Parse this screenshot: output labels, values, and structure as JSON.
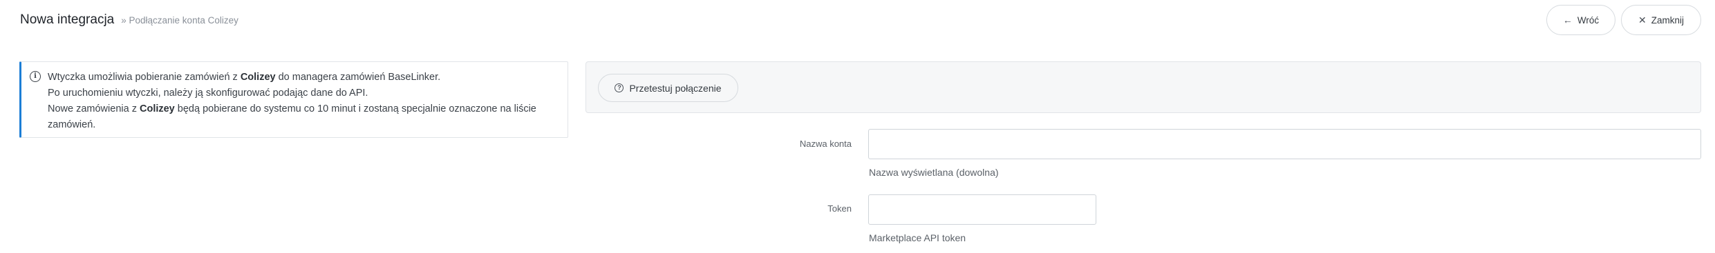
{
  "header": {
    "title": "Nowa integracja",
    "breadcrumb": "» Podłączanie konta Colizey",
    "back_label": "Wróć",
    "close_label": "Zamknij",
    "back_icon": "arrow-left-icon",
    "close_icon": "close-icon"
  },
  "info": {
    "icon": "info-icon",
    "line1_pre": "Wtyczka umożliwia pobieranie zamówień z ",
    "line1_bold": "Colizey",
    "line1_post": " do managera zamówień BaseLinker.",
    "line2": "Po uruchomieniu wtyczki, należy ją skonfigurować podając dane do API.",
    "line3_pre": "Nowe zamówienia z ",
    "line3_bold": "Colizey",
    "line3_post": " będą pobierane do systemu co 10 minut i zostaną specjalnie oznaczone na liście zamówień.",
    "accent_color": "#1c7ed6"
  },
  "test": {
    "label": "Przetestuj połączenie",
    "icon": "question-circle-icon"
  },
  "form": {
    "account": {
      "label": "Nazwa konta",
      "value": "",
      "placeholder": "",
      "help": "Nazwa wyświetlana (dowolna)"
    },
    "token": {
      "label": "Token",
      "value": "",
      "placeholder": "",
      "help": "Marketplace API token"
    }
  }
}
